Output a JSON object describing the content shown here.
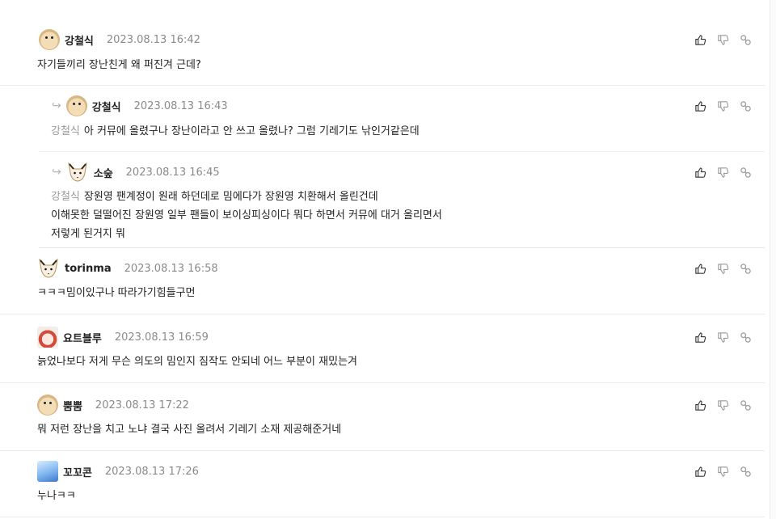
{
  "comments": [
    {
      "user": "강철식",
      "date": "2023.08.13 16:42",
      "lines": [
        "자기들끼리 장난친게 왜 퍼진겨 근데?"
      ]
    },
    {
      "user": "강철식",
      "date": "2023.08.13 16:43",
      "mention": "강철식",
      "lines": [
        "아 커뮤에 올렸구나 장난이라고 안 쓰고 올렸나? 그럼 기레기도 낚인거같은데"
      ]
    },
    {
      "user": "소숲",
      "date": "2023.08.13 16:45",
      "mention": "강철식",
      "lines": [
        "장원영 팬계정이 원래 하던데로 밈에다가 장원영 치환해서 올린건데",
        "이해못한 덜떨어진 장원영 일부 팬들이 보이싱피싱이다 뭐다 하면서 커뮤에 대거 올리면서",
        "저렇게 된거지 뭐"
      ]
    },
    {
      "user": "torinma",
      "date": "2023.08.13 16:58",
      "lines": [
        "ㅋㅋㅋ밈이있구나 따라가기힘들구먼"
      ]
    },
    {
      "user": "요트블루",
      "date": "2023.08.13 16:59",
      "lines": [
        "늙었나보다 저게 무슨 의도의 밈인지 짐작도 안되네 어느 부분이 재밌는겨"
      ]
    },
    {
      "user": "뿜뿜",
      "date": "2023.08.13 17:22",
      "lines": [
        "뭐 저런 장난을 치고 노냐 결국 사진 올려서 기레기 소재 제공해준거네"
      ]
    },
    {
      "user": "꼬꼬콘",
      "date": "2023.08.13 17:26",
      "lines": [
        "누나ㅋㅋ"
      ]
    }
  ],
  "icons": {
    "reply_arrow": "reply-arrow-icon",
    "like": "thumbs-up-icon",
    "dislike": "thumbs-down-icon",
    "share": "link-icon"
  },
  "colors": {
    "meta": "#8a8a8a",
    "mention": "#9a9a9a",
    "divider": "#ebebeb"
  }
}
